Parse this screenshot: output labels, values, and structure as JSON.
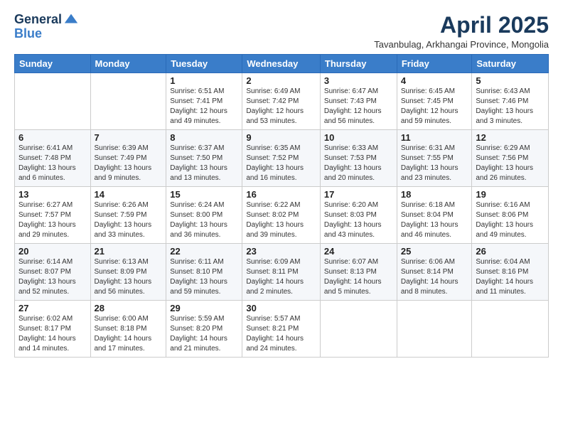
{
  "logo": {
    "general": "General",
    "blue": "Blue"
  },
  "header": {
    "month_title": "April 2025",
    "subtitle": "Tavanbulag, Arkhangai Province, Mongolia"
  },
  "weekdays": [
    "Sunday",
    "Monday",
    "Tuesday",
    "Wednesday",
    "Thursday",
    "Friday",
    "Saturday"
  ],
  "weeks": [
    [
      {
        "day": "",
        "info": ""
      },
      {
        "day": "",
        "info": ""
      },
      {
        "day": "1",
        "info": "Sunrise: 6:51 AM\nSunset: 7:41 PM\nDaylight: 12 hours and 49 minutes."
      },
      {
        "day": "2",
        "info": "Sunrise: 6:49 AM\nSunset: 7:42 PM\nDaylight: 12 hours and 53 minutes."
      },
      {
        "day": "3",
        "info": "Sunrise: 6:47 AM\nSunset: 7:43 PM\nDaylight: 12 hours and 56 minutes."
      },
      {
        "day": "4",
        "info": "Sunrise: 6:45 AM\nSunset: 7:45 PM\nDaylight: 12 hours and 59 minutes."
      },
      {
        "day": "5",
        "info": "Sunrise: 6:43 AM\nSunset: 7:46 PM\nDaylight: 13 hours and 3 minutes."
      }
    ],
    [
      {
        "day": "6",
        "info": "Sunrise: 6:41 AM\nSunset: 7:48 PM\nDaylight: 13 hours and 6 minutes."
      },
      {
        "day": "7",
        "info": "Sunrise: 6:39 AM\nSunset: 7:49 PM\nDaylight: 13 hours and 9 minutes."
      },
      {
        "day": "8",
        "info": "Sunrise: 6:37 AM\nSunset: 7:50 PM\nDaylight: 13 hours and 13 minutes."
      },
      {
        "day": "9",
        "info": "Sunrise: 6:35 AM\nSunset: 7:52 PM\nDaylight: 13 hours and 16 minutes."
      },
      {
        "day": "10",
        "info": "Sunrise: 6:33 AM\nSunset: 7:53 PM\nDaylight: 13 hours and 20 minutes."
      },
      {
        "day": "11",
        "info": "Sunrise: 6:31 AM\nSunset: 7:55 PM\nDaylight: 13 hours and 23 minutes."
      },
      {
        "day": "12",
        "info": "Sunrise: 6:29 AM\nSunset: 7:56 PM\nDaylight: 13 hours and 26 minutes."
      }
    ],
    [
      {
        "day": "13",
        "info": "Sunrise: 6:27 AM\nSunset: 7:57 PM\nDaylight: 13 hours and 29 minutes."
      },
      {
        "day": "14",
        "info": "Sunrise: 6:26 AM\nSunset: 7:59 PM\nDaylight: 13 hours and 33 minutes."
      },
      {
        "day": "15",
        "info": "Sunrise: 6:24 AM\nSunset: 8:00 PM\nDaylight: 13 hours and 36 minutes."
      },
      {
        "day": "16",
        "info": "Sunrise: 6:22 AM\nSunset: 8:02 PM\nDaylight: 13 hours and 39 minutes."
      },
      {
        "day": "17",
        "info": "Sunrise: 6:20 AM\nSunset: 8:03 PM\nDaylight: 13 hours and 43 minutes."
      },
      {
        "day": "18",
        "info": "Sunrise: 6:18 AM\nSunset: 8:04 PM\nDaylight: 13 hours and 46 minutes."
      },
      {
        "day": "19",
        "info": "Sunrise: 6:16 AM\nSunset: 8:06 PM\nDaylight: 13 hours and 49 minutes."
      }
    ],
    [
      {
        "day": "20",
        "info": "Sunrise: 6:14 AM\nSunset: 8:07 PM\nDaylight: 13 hours and 52 minutes."
      },
      {
        "day": "21",
        "info": "Sunrise: 6:13 AM\nSunset: 8:09 PM\nDaylight: 13 hours and 56 minutes."
      },
      {
        "day": "22",
        "info": "Sunrise: 6:11 AM\nSunset: 8:10 PM\nDaylight: 13 hours and 59 minutes."
      },
      {
        "day": "23",
        "info": "Sunrise: 6:09 AM\nSunset: 8:11 PM\nDaylight: 14 hours and 2 minutes."
      },
      {
        "day": "24",
        "info": "Sunrise: 6:07 AM\nSunset: 8:13 PM\nDaylight: 14 hours and 5 minutes."
      },
      {
        "day": "25",
        "info": "Sunrise: 6:06 AM\nSunset: 8:14 PM\nDaylight: 14 hours and 8 minutes."
      },
      {
        "day": "26",
        "info": "Sunrise: 6:04 AM\nSunset: 8:16 PM\nDaylight: 14 hours and 11 minutes."
      }
    ],
    [
      {
        "day": "27",
        "info": "Sunrise: 6:02 AM\nSunset: 8:17 PM\nDaylight: 14 hours and 14 minutes."
      },
      {
        "day": "28",
        "info": "Sunrise: 6:00 AM\nSunset: 8:18 PM\nDaylight: 14 hours and 17 minutes."
      },
      {
        "day": "29",
        "info": "Sunrise: 5:59 AM\nSunset: 8:20 PM\nDaylight: 14 hours and 21 minutes."
      },
      {
        "day": "30",
        "info": "Sunrise: 5:57 AM\nSunset: 8:21 PM\nDaylight: 14 hours and 24 minutes."
      },
      {
        "day": "",
        "info": ""
      },
      {
        "day": "",
        "info": ""
      },
      {
        "day": "",
        "info": ""
      }
    ]
  ]
}
